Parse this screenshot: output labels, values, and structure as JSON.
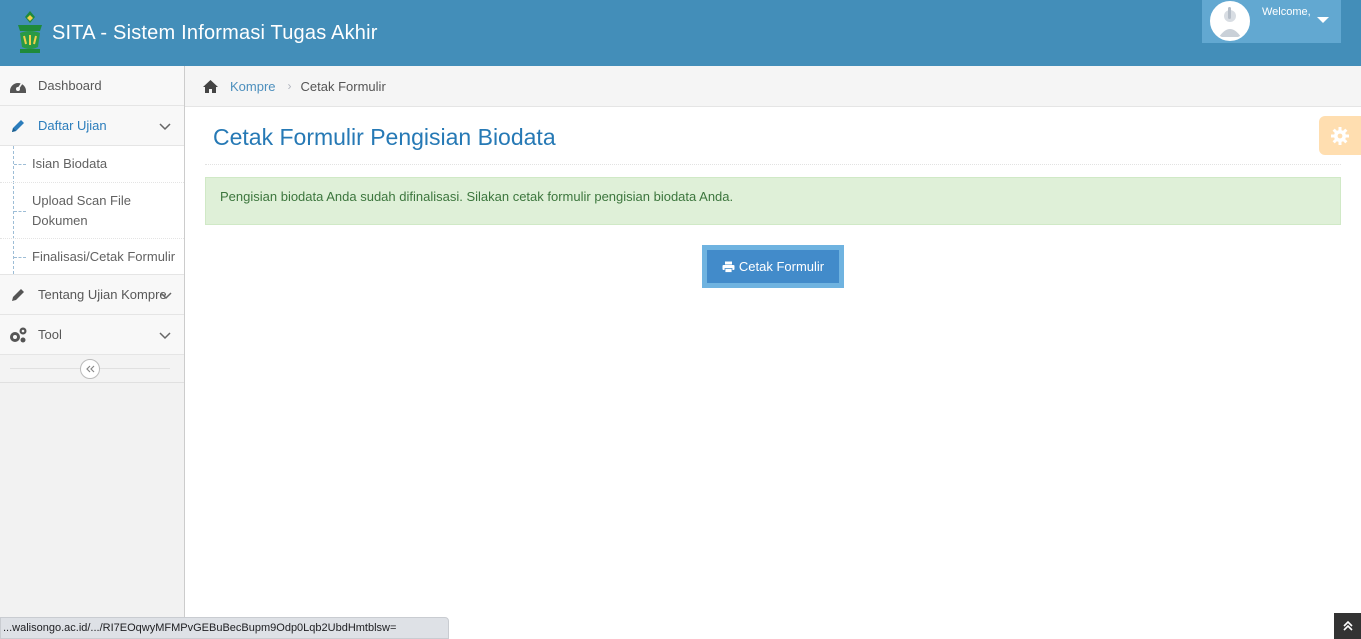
{
  "navbar": {
    "brand_title": "SITA - Sistem Informasi Tugas Akhir",
    "welcome_text": "Welcome,",
    "bg_color": "#438eb9"
  },
  "sidebar": {
    "items": [
      {
        "label": "Dashboard",
        "icon": "tachometer-icon"
      },
      {
        "label": "Daftar Ujian",
        "icon": "pencil-icon",
        "open": true,
        "submenu": [
          "Isian Biodata",
          "Upload Scan File Dokumen",
          "Finalisasi/Cetak Formulir"
        ]
      },
      {
        "label": "Tentang Ujian Kompre",
        "icon": "pencil-icon"
      },
      {
        "label": "Tool",
        "icon": "cogs-icon"
      }
    ]
  },
  "breadcrumb": {
    "home": "Kompre",
    "current": "Cetak Formulir"
  },
  "page": {
    "title": "Cetak Formulir Pengisian Biodata",
    "alert": "Pengisian biodata Anda sudah difinalisasi. Silakan cetak formulir pengisian biodata Anda.",
    "print_button": "Cetak Formulir"
  },
  "status_bar": {
    "url": "...walisongo.ac.id/.../RI7EOqwyMFMPvGEBuBecBupm9Odp0Lqb2UbdHmtblsw="
  }
}
